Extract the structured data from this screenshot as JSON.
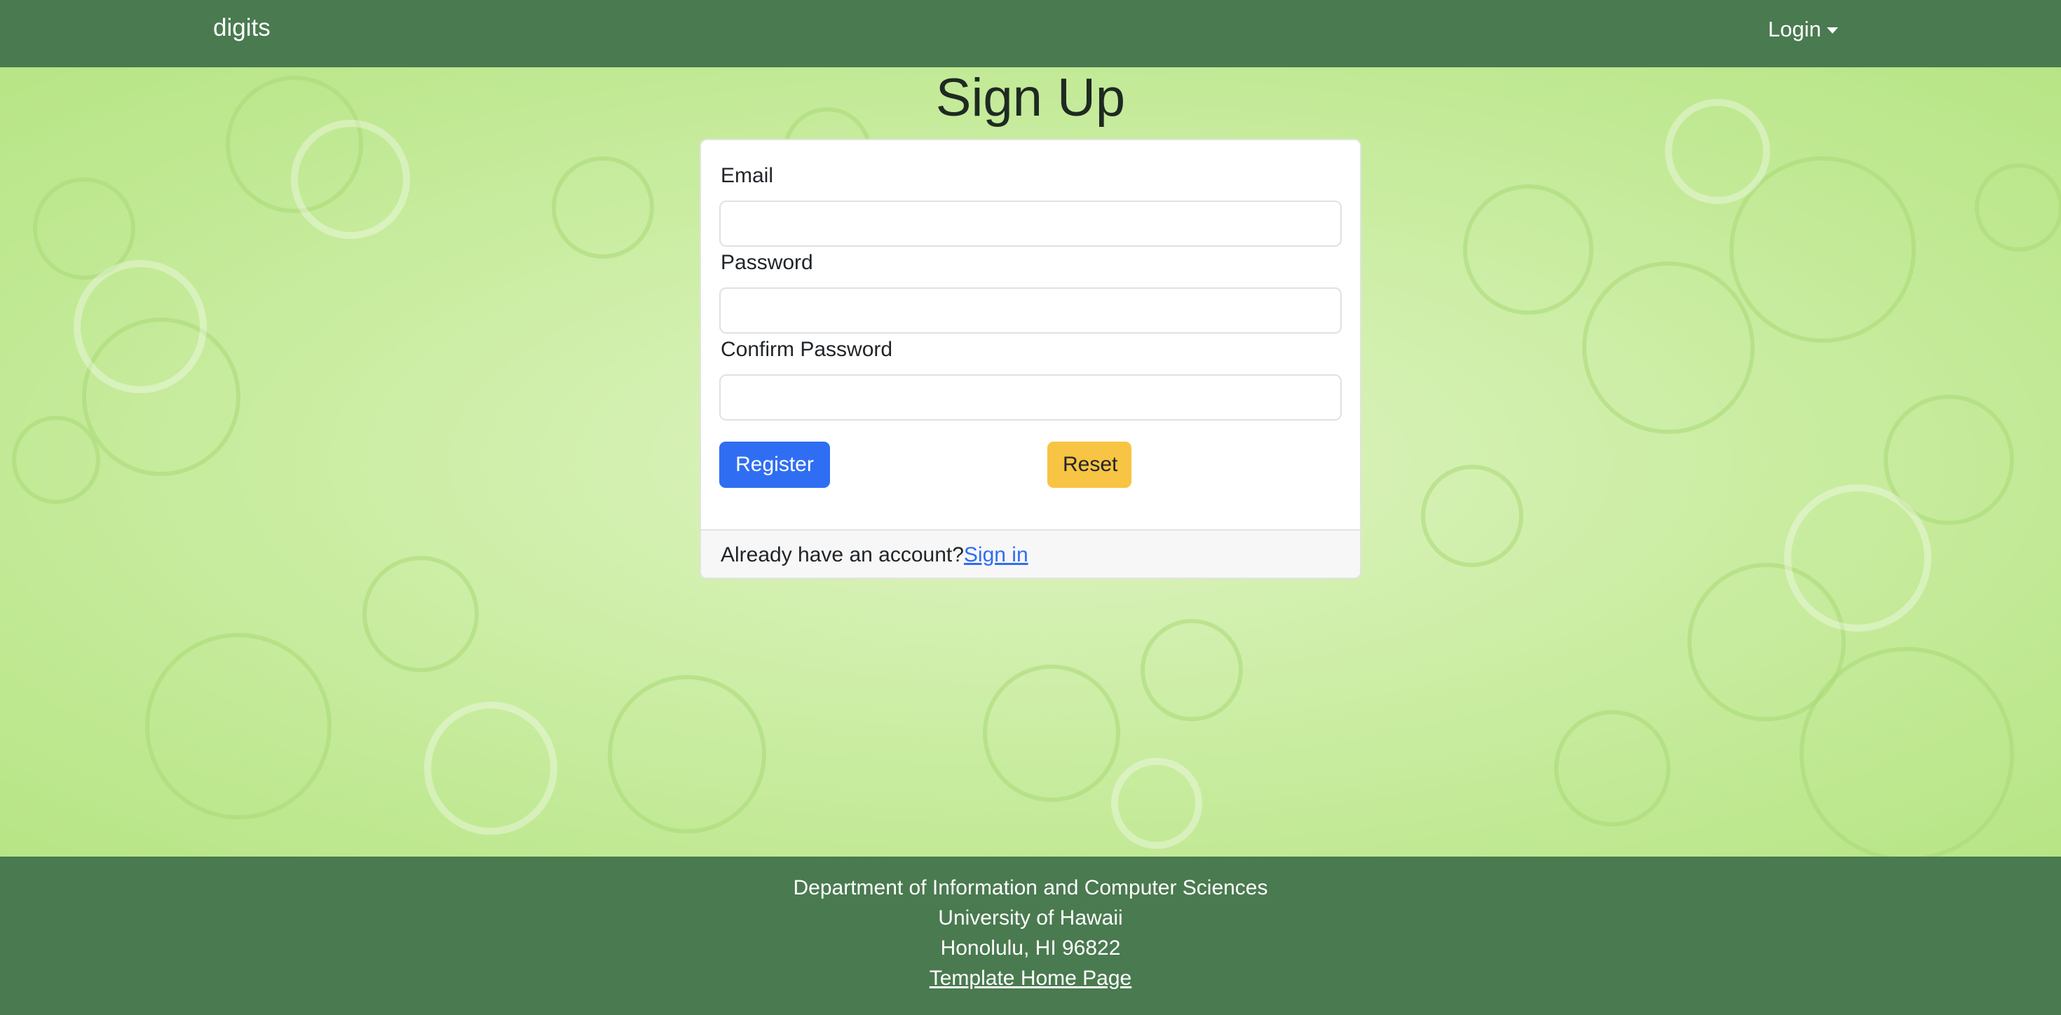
{
  "navbar": {
    "brand": "digits",
    "login_label": "Login"
  },
  "main": {
    "title": "Sign Up",
    "form": {
      "email_label": "Email",
      "email_value": "",
      "password_label": "Password",
      "password_value": "",
      "confirm_label": "Confirm Password",
      "confirm_value": "",
      "register_label": "Register",
      "reset_label": "Reset"
    },
    "footer": {
      "prompt": "Already have an account?",
      "link_label": "Sign in"
    }
  },
  "page_footer": {
    "line1": "Department of Information and Computer Sciences",
    "line2": "University of Hawaii",
    "line3": "Honolulu, HI 96822",
    "link_label": "Template Home Page"
  },
  "colors": {
    "navbar": "#4a7a50",
    "background": "#c6ec9a",
    "primary": "#2f6ef2",
    "warning": "#f8c443"
  }
}
